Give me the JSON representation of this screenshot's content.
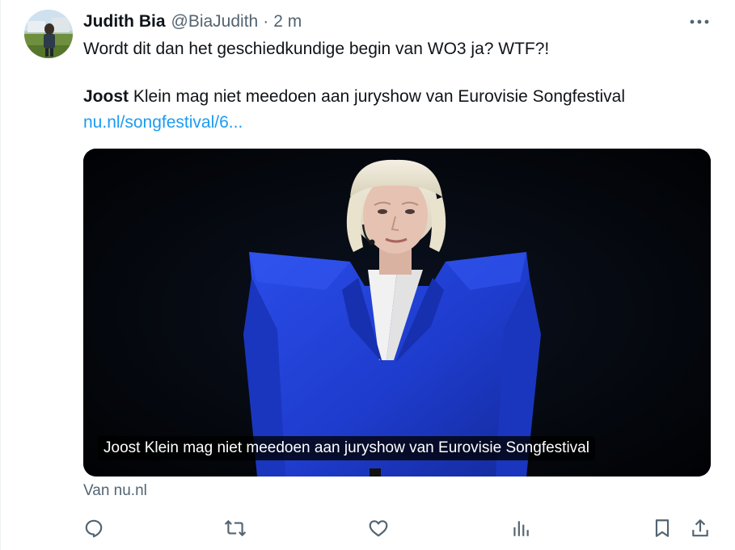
{
  "author": {
    "display_name": "Judith Bia",
    "handle": "@BiaJudith",
    "separator": "·",
    "time": "2 m"
  },
  "tweet": {
    "text": "Wordt dit dan het geschiedkundige begin van WO3 ja? WTF?!",
    "quote_bold": "Joost",
    "quote_rest": " Klein mag niet meedoen aan juryshow van Eurovisie Songfestival",
    "link": "nu.nl/songfestival/6..."
  },
  "card": {
    "caption": "Joost Klein mag niet meedoen aan juryshow van Eurovisie Songfestival",
    "source": "Van nu.nl"
  },
  "actions": [
    {
      "name": "reply",
      "icon": "reply-icon"
    },
    {
      "name": "retweet",
      "icon": "retweet-icon"
    },
    {
      "name": "like",
      "icon": "heart-icon"
    },
    {
      "name": "views",
      "icon": "analytics-icon"
    },
    {
      "name": "bookmark",
      "icon": "bookmark-icon"
    },
    {
      "name": "share",
      "icon": "share-icon"
    }
  ],
  "colors": {
    "link": "#1d9bf0",
    "secondary_text": "#536471",
    "primary_text": "#0f1419",
    "suit_blue": "#1f3fd6"
  }
}
